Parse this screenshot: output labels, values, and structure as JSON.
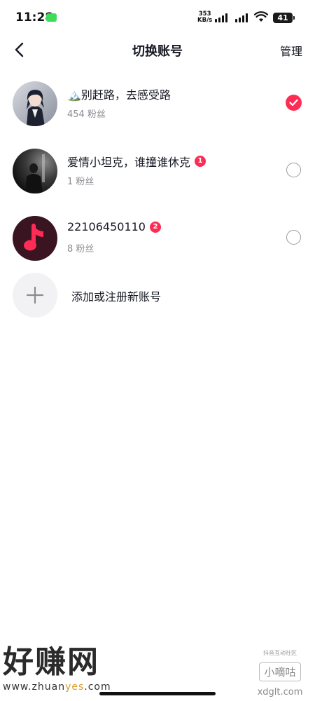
{
  "status_bar": {
    "time": "11:28",
    "net_speed_value": "353",
    "net_speed_unit": "KB/s",
    "battery": "41"
  },
  "header": {
    "title": "切换账号",
    "manage_label": "管理"
  },
  "accounts": [
    {
      "name": "🏔️别赶路，去感受路",
      "fans": "454 粉丝",
      "badge": "",
      "selected": true
    },
    {
      "name": "爱情小坦克，谁撞谁休克",
      "fans": "1 粉丝",
      "badge": "1",
      "selected": false
    },
    {
      "name": "22106450110",
      "fans": "8 粉丝",
      "badge": "2",
      "selected": false
    }
  ],
  "add_account": {
    "label": "添加或注册新账号"
  },
  "watermarks": {
    "left_big": "好赚网",
    "left_url_a": "www.zhuan",
    "left_url_b": "yes",
    "left_url_c": ".com",
    "right_small": "抖音互动社区",
    "right_box": "小嘀咕",
    "right_site": "xdglt.com"
  },
  "colors": {
    "accent": "#fe2c55",
    "secondary_text": "#8a8b91"
  }
}
